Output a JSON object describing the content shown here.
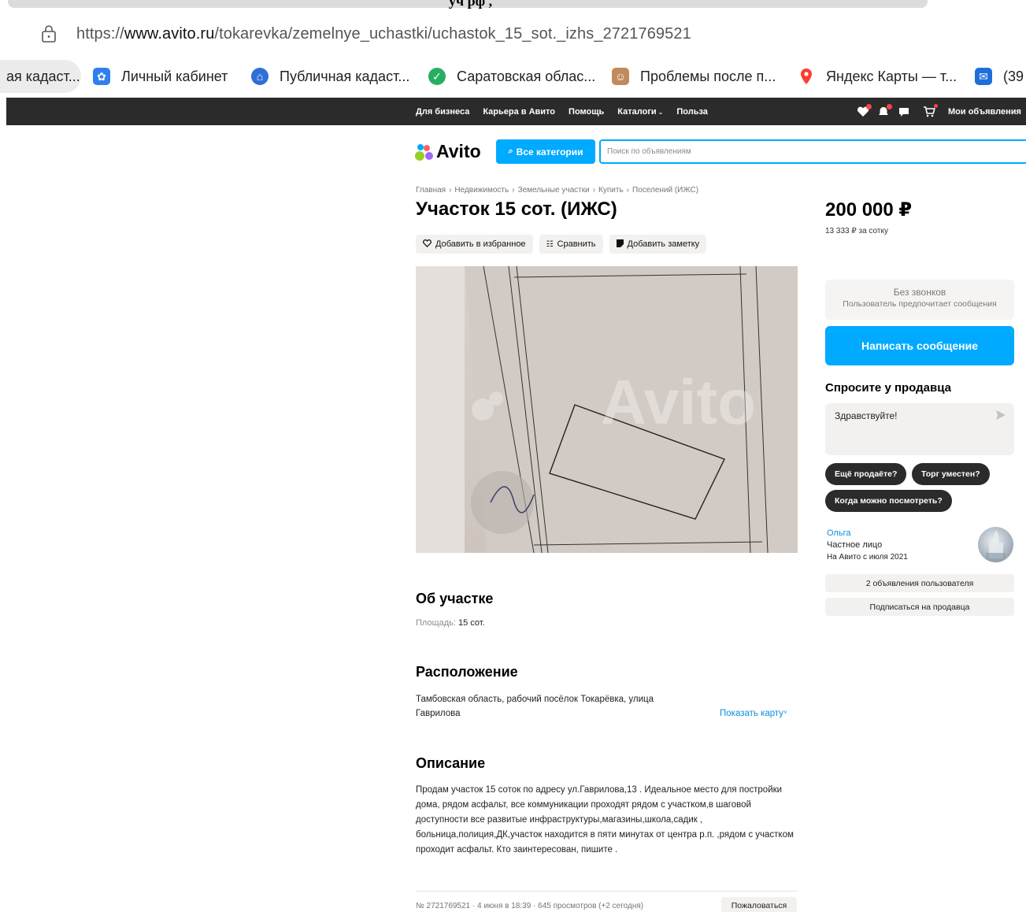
{
  "top_fragment": {
    "text": "уч    рф    ,   "
  },
  "browser": {
    "url_scheme": "https://",
    "url_host": "www.avito.ru",
    "url_path": "/tokarevka/zemelnye_uchastki/uchastok_15_sot._izhs_2721769521"
  },
  "bookmarks": [
    {
      "label": "ая кадаст...",
      "icon": "none"
    },
    {
      "label": "Личный кабинет",
      "icon": "gosuslugi-icon",
      "color": "#2f80ed"
    },
    {
      "label": "Публичная кадаст...",
      "icon": "rosreestr-icon",
      "color": "#2f6fd6"
    },
    {
      "label": "Саратовская облас...",
      "icon": "check-icon",
      "color": "#27ae60"
    },
    {
      "label": "Проблемы после п...",
      "icon": "avatar-icon",
      "color": "#c08a5a"
    },
    {
      "label": "Яндекс Карты — т...",
      "icon": "map-pin-icon",
      "color": "#ff3b30"
    },
    {
      "label": "(39",
      "icon": "mail-icon",
      "color": "#1e6fd9"
    }
  ],
  "topnav": {
    "links": [
      "Для бизнеса",
      "Карьера в Авито",
      "Помощь",
      "Каталоги",
      "Польза"
    ],
    "my_ads": "Мои объявления"
  },
  "header": {
    "logo": "Avito",
    "categories_button": "Все категории",
    "search_placeholder": "Поиск по объявлениям"
  },
  "breadcrumbs": [
    "Главная",
    "Недвижимость",
    "Земельные участки",
    "Купить",
    "Поселений (ИЖС)"
  ],
  "listing": {
    "title": "Участок 15 сот. (ИЖС)",
    "price": "200 000 ₽",
    "price_per_unit": "13 333 ₽ за сотку",
    "actions": [
      "Добавить в избранное",
      "Сравнить",
      "Добавить заметку"
    ],
    "photo_watermark": "Avito",
    "about_heading": "Об участке",
    "area_label": "Площадь: ",
    "area_value": "15 сот.",
    "location_heading": "Расположение",
    "address": "Тамбовская область, рабочий посёлок Токарёвка, улица Гаврилова",
    "show_map": "Показать карту",
    "description_heading": "Описание",
    "description": "Продам участок 15 соток по адресу ул.Гаврилова,13 . Идеальное место для постройки дома, рядом асфальт, все коммуникации проходят рядом с участком,в шаговой доступности все развитые инфраструктуры,магазины,школа,садик , больница,полиция,ДК,участок находится в пяти минутах от центра р.п. ,рядом с участком проходит асфальт. Кто заинтересован, пишите .",
    "footer_meta": "№ 2721769521 · 4 июня в 18:39 · 645 просмотров (+2 сегодня)",
    "report_button": "Пожаловаться"
  },
  "seller_panel": {
    "no_calls_title": "Без звонков",
    "no_calls_sub": "Пользователь предпочитает сообщения",
    "write_button": "Написать сообщение",
    "ask_heading": "Спросите у продавца",
    "ask_value": "Здравствуйте!",
    "chips": [
      "Ещё продаёте?",
      "Торг уместен?",
      "Когда можно посмотреть?"
    ],
    "seller_name": "Ольга",
    "seller_type": "Частное лицо",
    "seller_since": "На Авито с июля 2021",
    "ads_button": "2 объявления пользователя",
    "subscribe_button": "Подписаться на продавца"
  },
  "colors": {
    "accent": "#00aaff",
    "dark": "#2b2b2b",
    "link": "#0a8ee0"
  }
}
